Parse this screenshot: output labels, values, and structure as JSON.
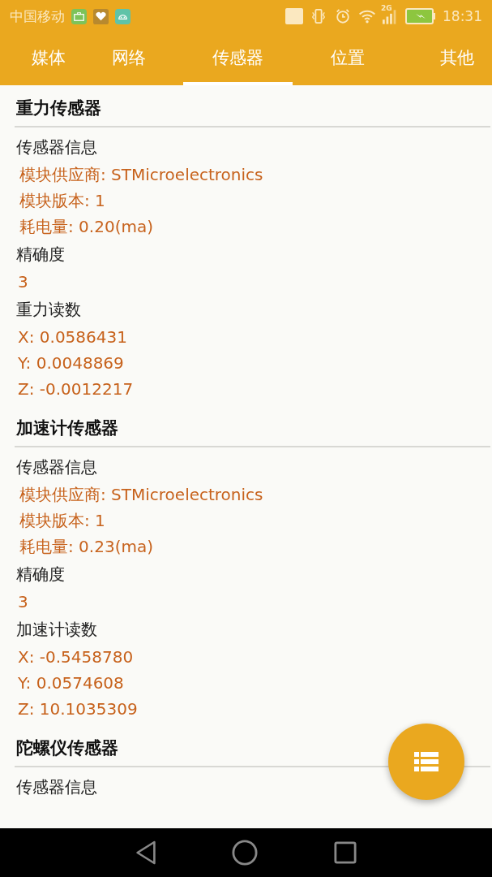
{
  "status_bar": {
    "carrier": "中国移动",
    "network": "2G",
    "time": "18:31"
  },
  "tabs": [
    {
      "label": "媒体",
      "selected": false
    },
    {
      "label": "网络",
      "selected": false
    },
    {
      "label": "传感器",
      "selected": true
    },
    {
      "label": "位置",
      "selected": false
    },
    {
      "label": "其他",
      "selected": false
    }
  ],
  "sections": [
    {
      "title": "重力传感器",
      "groups": [
        {
          "label": "传感器信息",
          "kind": "info",
          "values": [
            "模块供应商: STMicroelectronics",
            "模块版本: 1",
            "耗电量: 0.20(ma)"
          ]
        },
        {
          "label": "精确度",
          "kind": "plain",
          "values": [
            "3"
          ]
        },
        {
          "label": "重力读数",
          "kind": "plain",
          "values": [
            "X: 0.0586431",
            "Y: 0.0048869",
            "Z: -0.0012217"
          ]
        }
      ]
    },
    {
      "title": "加速计传感器",
      "groups": [
        {
          "label": "传感器信息",
          "kind": "info",
          "values": [
            "模块供应商: STMicroelectronics",
            "模块版本: 1",
            "耗电量: 0.23(ma)"
          ]
        },
        {
          "label": "精确度",
          "kind": "plain",
          "values": [
            "3"
          ]
        },
        {
          "label": "加速计读数",
          "kind": "plain",
          "values": [
            "X: -0.5458780",
            "Y: 0.0574608",
            "Z: 10.1035309"
          ]
        }
      ]
    },
    {
      "title": "陀螺仪传感器",
      "groups": [
        {
          "label": "传感器信息",
          "kind": "info"
        }
      ]
    }
  ]
}
